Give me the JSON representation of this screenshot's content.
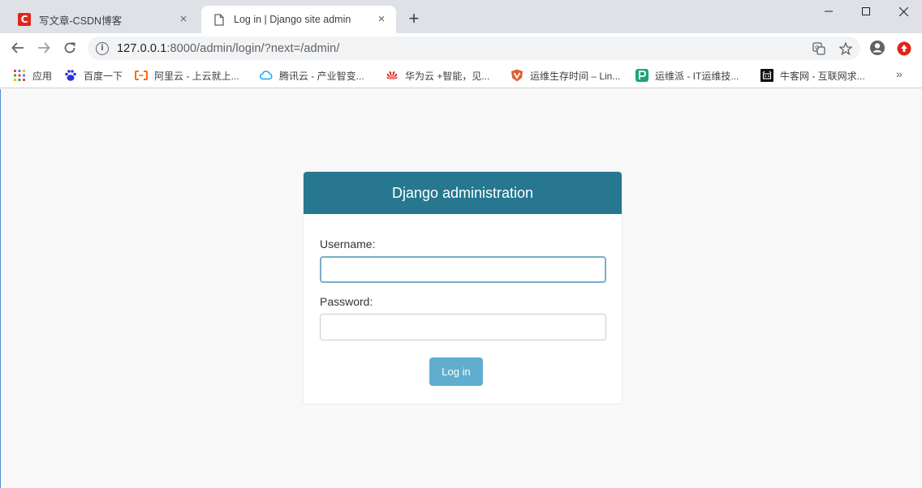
{
  "browser": {
    "tabs": [
      {
        "title": "写文章-CSDN博客",
        "icon": "csdn-logo-icon",
        "active": false
      },
      {
        "title": "Log in | Django site admin",
        "icon": "page-icon",
        "active": true
      }
    ],
    "close_symbol": "×",
    "new_tab_symbol": "+",
    "address": {
      "host": "127.0.0.1",
      "path": ":8000/admin/login/?next=/admin/"
    },
    "bookmarks": [
      {
        "label": "应用",
        "icon": "apps-grid-icon"
      },
      {
        "label": "百度一下",
        "icon": "baidu-paw-icon"
      },
      {
        "label": "阿里云 - 上云就上...",
        "icon": "aliyun-icon"
      },
      {
        "label": "腾讯云 - 产业智变...",
        "icon": "tencent-cloud-icon"
      },
      {
        "label": "华为云 +智能，见...",
        "icon": "huawei-icon"
      },
      {
        "label": "运维生存时间 – Lin...",
        "icon": "shield-icon"
      },
      {
        "label": "运维派 - IT运维技...",
        "icon": "yunweipai-icon"
      },
      {
        "label": "牛客网 - 互联网求...",
        "icon": "nowcoder-icon"
      }
    ],
    "more_symbol": "»"
  },
  "login": {
    "header": "Django administration",
    "username_label": "Username:",
    "username_value": "",
    "password_label": "Password:",
    "password_value": "",
    "submit_label": "Log in"
  },
  "colors": {
    "header_bg": "#26778f",
    "button_bg": "#5faece",
    "focus_border": "#79aec8"
  }
}
